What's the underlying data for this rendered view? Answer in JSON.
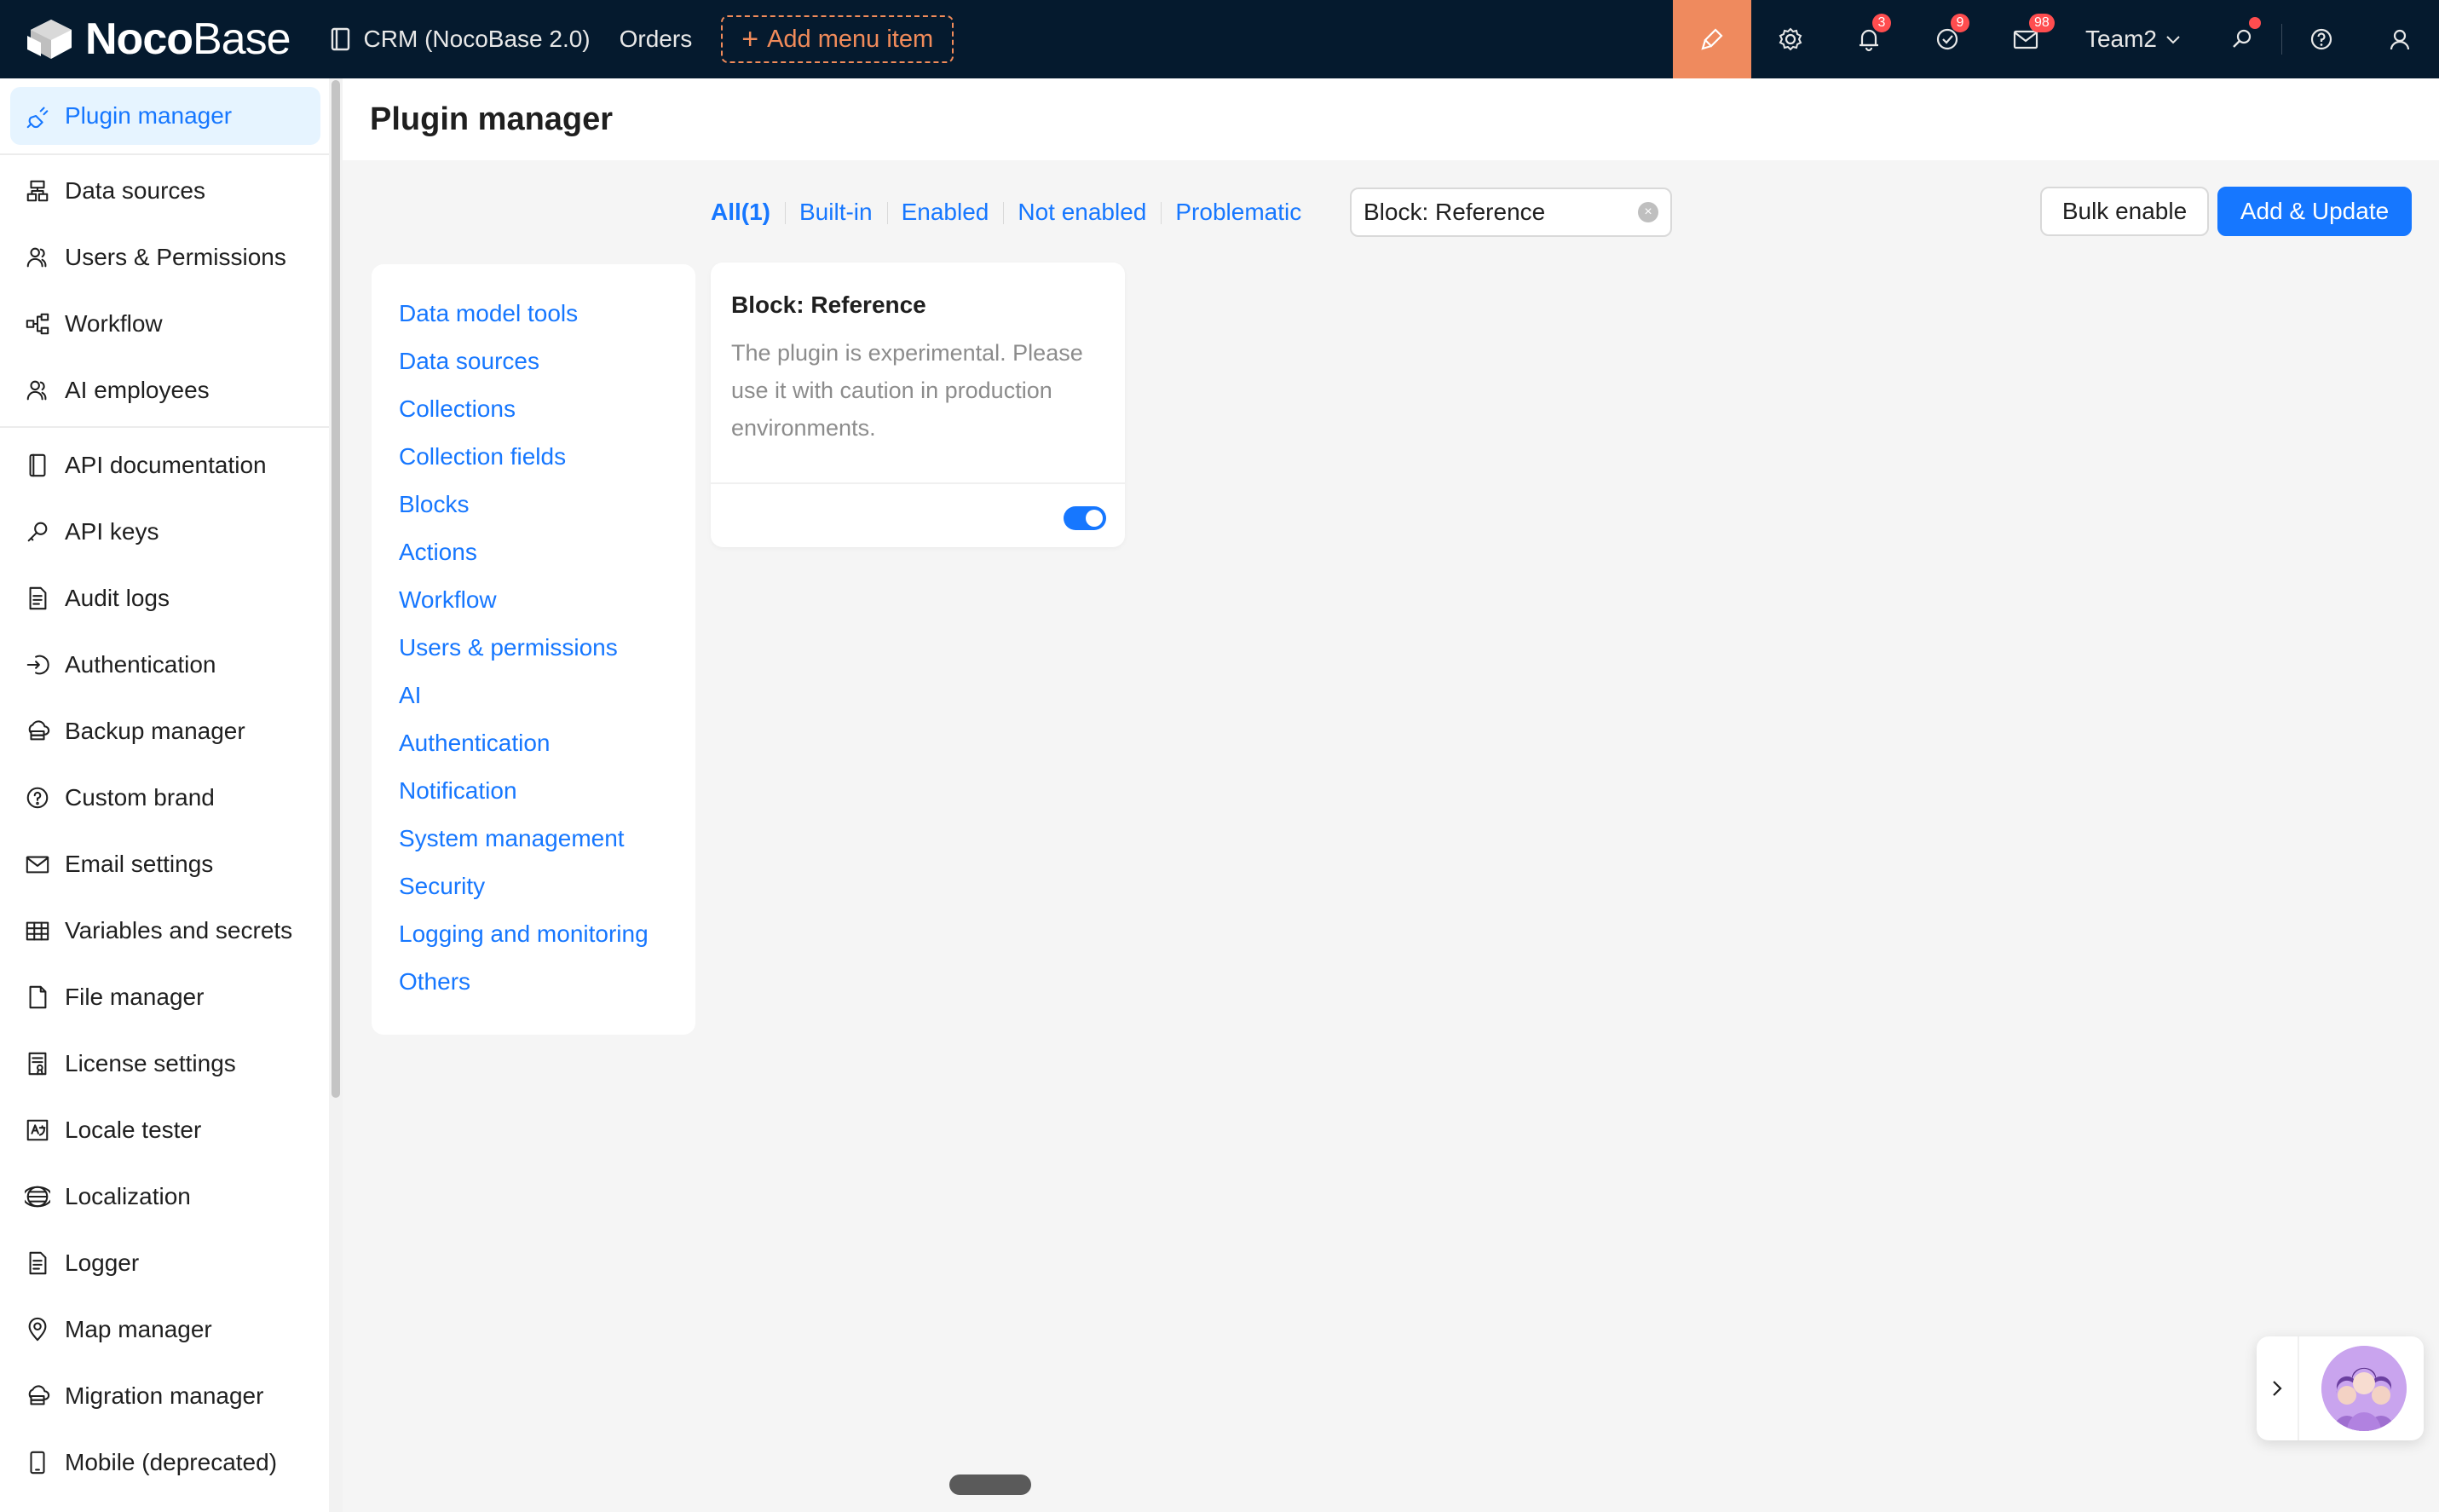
{
  "header": {
    "logo_bold": "Noco",
    "logo_light": "Base",
    "nav": [
      {
        "label": "CRM (NocoBase 2.0)",
        "icon": "book-icon"
      },
      {
        "label": "Orders"
      }
    ],
    "add_menu_label": "Add menu item",
    "badges": {
      "notifications": "3",
      "tasks": "9",
      "messages": "98"
    },
    "team_label": "Team2",
    "accent_color": "#ef8a5e",
    "bg_color": "#051a2e"
  },
  "sidebar": {
    "items": [
      {
        "label": "Plugin manager",
        "icon": "plug-icon",
        "active": true
      },
      {
        "label": "Data sources",
        "icon": "database-icon"
      },
      {
        "label": "Users & Permissions",
        "icon": "users-icon"
      },
      {
        "label": "Workflow",
        "icon": "workflow-icon"
      },
      {
        "label": "AI employees",
        "icon": "ai-user-icon"
      },
      {
        "label": "API documentation",
        "icon": "book-icon"
      },
      {
        "label": "API keys",
        "icon": "key-icon"
      },
      {
        "label": "Audit logs",
        "icon": "file-text-icon"
      },
      {
        "label": "Authentication",
        "icon": "login-icon"
      },
      {
        "label": "Backup manager",
        "icon": "cloud-server-icon"
      },
      {
        "label": "Custom brand",
        "icon": "question-circle-icon"
      },
      {
        "label": "Email settings",
        "icon": "mail-icon"
      },
      {
        "label": "Variables and secrets",
        "icon": "table-icon"
      },
      {
        "label": "File manager",
        "icon": "file-icon"
      },
      {
        "label": "License settings",
        "icon": "certificate-icon"
      },
      {
        "label": "Locale tester",
        "icon": "translate-icon"
      },
      {
        "label": "Localization",
        "icon": "globe-icon"
      },
      {
        "label": "Logger",
        "icon": "file-text-icon"
      },
      {
        "label": "Map manager",
        "icon": "map-pin-icon"
      },
      {
        "label": "Migration manager",
        "icon": "cloud-server-icon"
      },
      {
        "label": "Mobile (deprecated)",
        "icon": "mobile-icon"
      }
    ]
  },
  "page": {
    "title": "Plugin manager",
    "filters": [
      "All(1)",
      "Built-in",
      "Enabled",
      "Not enabled",
      "Problematic"
    ],
    "search_value": "Block: Reference",
    "bulk_enable_label": "Bulk enable",
    "add_update_label": "Add & Update",
    "primary_color": "#1677ff"
  },
  "categories": [
    "Data model tools",
    "Data sources",
    "Collections",
    "Collection fields",
    "Blocks",
    "Actions",
    "Workflow",
    "Users & permissions",
    "AI",
    "Authentication",
    "Notification",
    "System management",
    "Security",
    "Logging and monitoring",
    "Others"
  ],
  "plugin_card": {
    "title": "Block: Reference",
    "description": "The plugin is experimental. Please use it with caution in production environments.",
    "enabled": true
  }
}
